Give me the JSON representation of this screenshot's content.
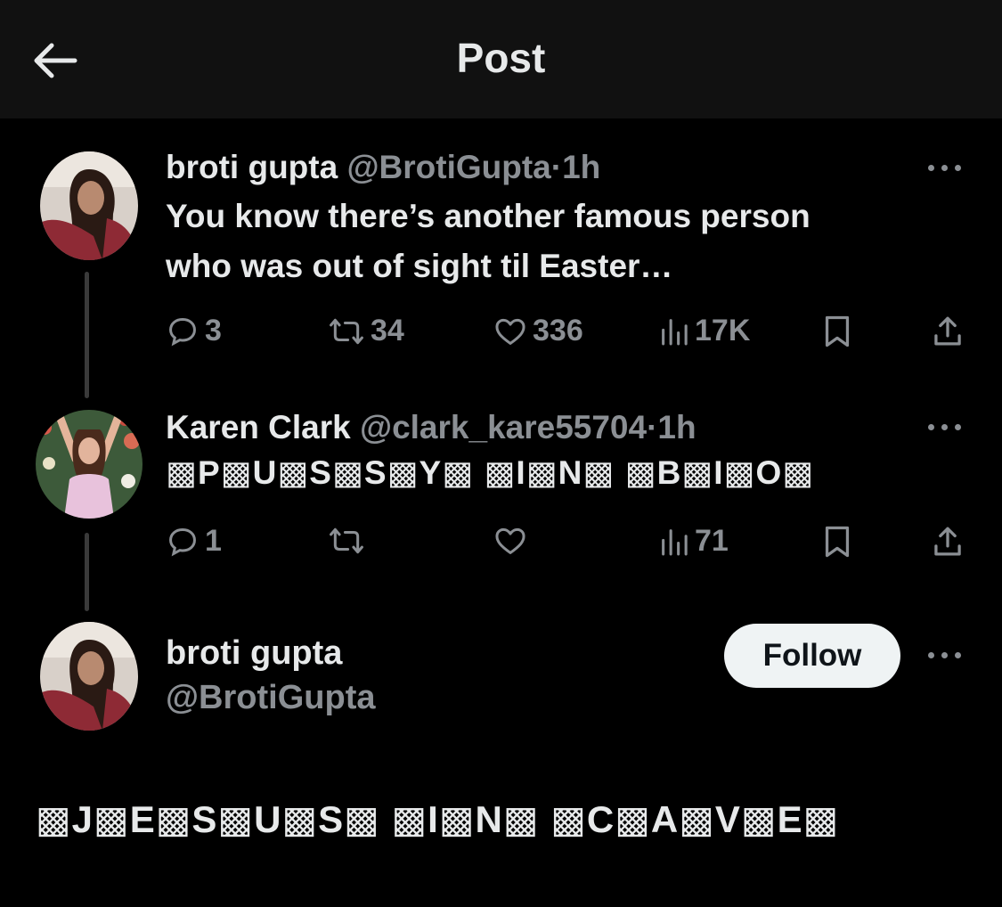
{
  "header": {
    "title": "Post"
  },
  "tweet1": {
    "name": "broti gupta",
    "handle": "@BrotiGupta",
    "sep": "·",
    "time": "1h",
    "text_line1": "You know there’s another famous person",
    "text_line2": "who was out of sight til Easter…",
    "replies": "3",
    "reposts": "34",
    "likes": "336",
    "views": "17K"
  },
  "tweet2": {
    "name": "Karen Clark",
    "handle": "@clark_kare55704",
    "sep": "·",
    "time": "1h",
    "text": "▩P▩U▩S▩S▩Y▩ ▩I▩N▩ ▩B▩I▩O▩",
    "replies": "1",
    "reposts": "",
    "likes": "",
    "views": "71"
  },
  "main_post": {
    "name": "broti gupta",
    "handle": "@BrotiGupta",
    "follow_label": "Follow",
    "text": "▩J▩E▩S▩U▩S▩ ▩I▩N▩ ▩C▩A▩V▩E▩"
  },
  "icons": [
    "back-arrow-icon",
    "more-icon",
    "reply-icon",
    "repost-icon",
    "like-icon",
    "views-icon",
    "bookmark-icon",
    "share-icon"
  ],
  "colors": {
    "background": "#000000",
    "header_bg": "#111111",
    "text": "#e7e9ea",
    "muted": "#8b8f94",
    "follow_bg": "#eff3f4"
  }
}
